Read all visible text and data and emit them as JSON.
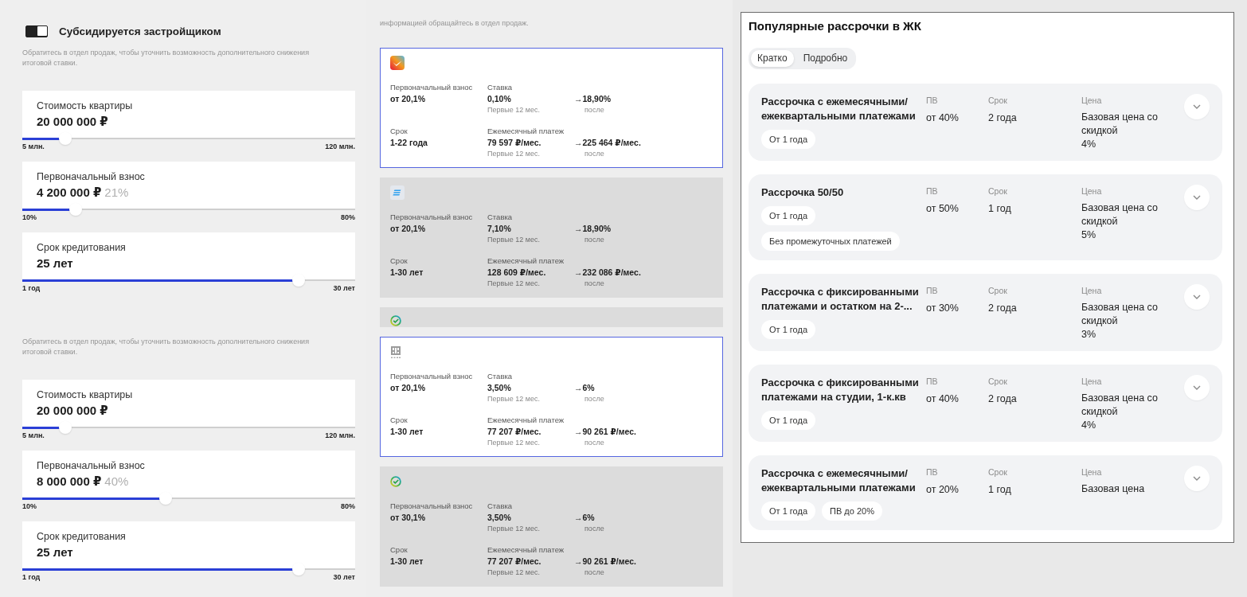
{
  "calculators": [
    {
      "toggle": {
        "label": "Субсидируется застройщиком",
        "on": true
      },
      "note": "Обратитесь в отдел продаж, чтобы уточнить возможность дополнительного снижения итоговой ставки.",
      "sliders": [
        {
          "label": "Стоимость квартиры",
          "value": "20 000 000 ₽",
          "min": "5 млн.",
          "max": "120 млн.",
          "level": 0.13
        },
        {
          "label": "Первоначальный взнос",
          "value": "4 200 000 ₽",
          "share": "21%",
          "min": "10%",
          "max": "80%",
          "level": 0.16
        },
        {
          "label": "Срок кредитования",
          "value": "25 лет",
          "min": "1 год",
          "max": "30 лет",
          "level": 0.83
        }
      ]
    },
    {
      "note": "Обратитесь в отдел продаж, чтобы уточнить возможность дополнительного снижения итоговой ставки.",
      "sliders": [
        {
          "label": "Стоимость квартиры",
          "value": "20 000 000 ₽",
          "min": "5 млн.",
          "max": "120 млн.",
          "level": 0.13
        },
        {
          "label": "Первоначальный взнос",
          "value": "8 000 000 ₽",
          "share": "40%",
          "min": "10%",
          "max": "80%",
          "level": 0.43
        },
        {
          "label": "Срок кредитования",
          "value": "25 лет",
          "min": "1 год",
          "max": "30 лет",
          "level": 0.83
        }
      ]
    }
  ],
  "offers": {
    "note": "информацией обращайтесь в отдел продаж.",
    "cards": [
      {
        "kind": "tile",
        "selected": true,
        "cells": [
          {
            "label": "Первоначальный взнос",
            "value": "от 20,1%"
          },
          {
            "label": "Ставка",
            "value": "0,10%",
            "note": "Первые 12 мес."
          },
          {
            "value": "→18,90%",
            "note": "после"
          },
          {
            "label": "Срок",
            "value": "1-22 года"
          },
          {
            "label": "Ежемесячный платеж",
            "value": "79 597 ₽/мес.",
            "note": "Первые 12 мес."
          },
          {
            "value": "→225 464 ₽/мес.",
            "note": "после"
          }
        ]
      },
      {
        "kind": "stripes",
        "selected": false,
        "cells": [
          {
            "label": "Первоначальный взнос",
            "value": "от 20,1%"
          },
          {
            "label": "Ставка",
            "value": "7,10%",
            "note": "Первые 12 мес."
          },
          {
            "value": "→18,90%",
            "note": "после"
          },
          {
            "label": "Срок",
            "value": "1-30 лет"
          },
          {
            "label": "Ежемесячный платеж",
            "value": "128 609 ₽/мес.",
            "note": "Первые 12 мес."
          },
          {
            "value": "→232 086 ₽/мес.",
            "note": "после"
          }
        ]
      },
      {
        "kind": "ring",
        "selected": false
      },
      {
        "kind": "tower",
        "selected": true,
        "cells": [
          {
            "label": "Первоначальный взнос",
            "value": "от 20,1%"
          },
          {
            "label": "Ставка",
            "value": "3,50%",
            "note": "Первые 12 мес."
          },
          {
            "value": "→6%",
            "note": "после"
          },
          {
            "label": "Срок",
            "value": "1-30 лет"
          },
          {
            "label": "Ежемесячный платеж",
            "value": "77 207 ₽/мес.",
            "note": "Первые 12 мес."
          },
          {
            "value": "→90 261 ₽/мес.",
            "note": "после"
          }
        ]
      },
      {
        "kind": "ring",
        "selected": false,
        "cells": [
          {
            "label": "Первоначальный взнос",
            "value": "от 30,1%"
          },
          {
            "label": "Ставка",
            "value": "3,50%",
            "note": "Первые 12 мес."
          },
          {
            "value": "→6%",
            "note": "после"
          },
          {
            "label": "Срок",
            "value": "1-30 лет"
          },
          {
            "label": "Ежемесячный платеж",
            "value": "77 207 ₽/мес.",
            "note": "Первые 12 мес."
          },
          {
            "value": "→90 261 ₽/мес.",
            "note": "после"
          }
        ]
      }
    ]
  },
  "installments": {
    "title": "Популярные рассрочки в ЖК",
    "tabs": [
      {
        "label": "Кратко",
        "selected": true
      },
      {
        "label": "Подробно",
        "selected": false
      }
    ],
    "cards": [
      {
        "title": "Рассрочка с ежемесячными/ежеквартальными платежами",
        "tags": [
          "От 1 года"
        ],
        "pv_label": "ПВ",
        "pv": "от 40%",
        "term_label": "Срок",
        "term": "2 года",
        "price_label": "Цена",
        "price": "Базовая цена со скидкой",
        "discount": "4%"
      },
      {
        "title": "Рассрочка 50/50",
        "tags": [
          "От 1 года",
          "Без промежуточных платежей"
        ],
        "pv_label": "ПВ",
        "pv": "от 50%",
        "term_label": "Срок",
        "term": "1 год",
        "price_label": "Цена",
        "price": "Базовая цена со скидкой",
        "discount": "5%"
      },
      {
        "title": "Рассрочка с фиксированными платежами и остатком на 2-...",
        "tags": [
          "От 1 года"
        ],
        "pv_label": "ПВ",
        "pv": "от 30%",
        "term_label": "Срок",
        "term": "2 года",
        "price_label": "Цена",
        "price": "Базовая цена со скидкой",
        "discount": "3%"
      },
      {
        "title": "Рассрочка с фиксированными платежами на студии, 1-к.кв",
        "tags": [
          "От 1 года"
        ],
        "pv_label": "ПВ",
        "pv": "от 40%",
        "term_label": "Срок",
        "term": "2 года",
        "price_label": "Цена",
        "price": "Базовая цена со скидкой",
        "discount": "4%"
      },
      {
        "title": "Рассрочка с ежемесячными/ежеквартальными платежами",
        "tags": [
          "От 1 года",
          "ПВ до 20%"
        ],
        "pv_label": "ПВ",
        "pv": "от 20%",
        "term_label": "Срок",
        "term": "1 год",
        "price_label": "Цена",
        "price": "Базовая цена"
      }
    ]
  }
}
